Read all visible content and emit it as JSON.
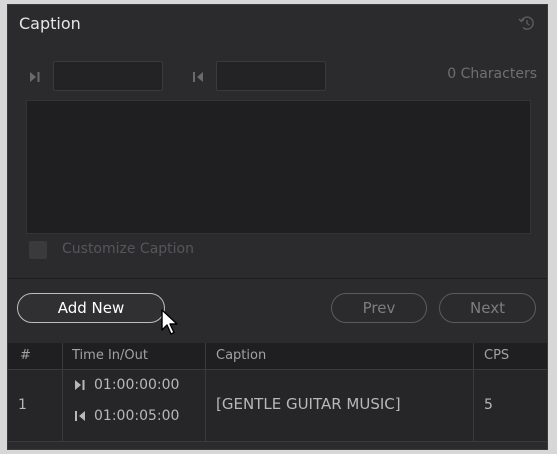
{
  "panel": {
    "title": "Caption",
    "character_count": "0 Characters",
    "customize_label": "Customize Caption"
  },
  "buttons": {
    "add_new": "Add New",
    "prev": "Prev",
    "next": "Next"
  },
  "table": {
    "headers": [
      "#",
      "Time In/Out",
      "Caption",
      "CPS"
    ],
    "rows": [
      {
        "index": "1",
        "time_in": "01:00:00:00",
        "time_out": "01:00:05:00",
        "caption": "[GENTLE GUITAR MUSIC]",
        "cps": "5"
      }
    ]
  },
  "icons": {
    "reset": "reset-icon",
    "mark_in": "mark-in-icon",
    "mark_out": "mark-out-icon",
    "cursor": "mouse-pointer-icon"
  },
  "colors": {
    "panel_bg": "#2b2b2d",
    "outer_bg": "#d7d7d7",
    "text_primary": "#e6e6e6",
    "text_muted": "#6f6f72"
  }
}
